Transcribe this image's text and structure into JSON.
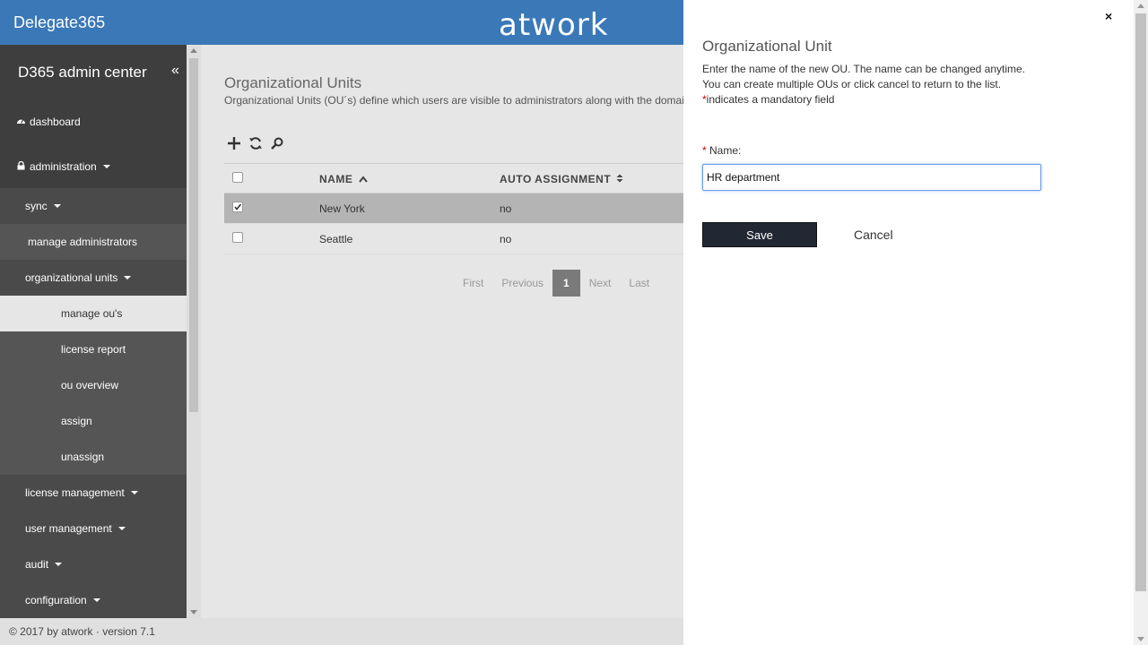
{
  "header": {
    "brand": "Delegate365",
    "logo": "atwork"
  },
  "sidebar": {
    "title": "D365 admin center",
    "collapse_icon": "«",
    "items": [
      {
        "label": "dashboard",
        "icon": "dashboard-icon"
      },
      {
        "label": "administration",
        "icon": "lock-icon"
      },
      {
        "label": "sync"
      },
      {
        "label": "manage administrators"
      },
      {
        "label": "organizational units"
      },
      {
        "label": "manage ou's"
      },
      {
        "label": "license report"
      },
      {
        "label": "ou overview"
      },
      {
        "label": "assign"
      },
      {
        "label": "unassign"
      },
      {
        "label": "license management"
      },
      {
        "label": "user management"
      },
      {
        "label": "audit"
      },
      {
        "label": "configuration"
      }
    ]
  },
  "main": {
    "title": "Organizational Units",
    "description": "Organizational Units (OU´s) define which users are visible to administrators along with the domai",
    "toolbar": {
      "add_icon": "plus-icon",
      "refresh_icon": "refresh-icon",
      "search_icon": "search-icon"
    },
    "table": {
      "columns": [
        "NAME",
        "AUTO ASSIGNMENT"
      ],
      "rows": [
        {
          "name": "New York",
          "auto_assignment": "no",
          "selected": true
        },
        {
          "name": "Seattle",
          "auto_assignment": "no",
          "selected": false
        }
      ]
    },
    "pager": {
      "first": "First",
      "previous": "Previous",
      "current": "1",
      "next": "Next",
      "last": "Last"
    }
  },
  "footer": {
    "text": "© 2017 by atwork · version 7.1"
  },
  "dialog": {
    "title": "Organizational Unit",
    "line1": "Enter the name of the new OU. The name can be changed anytime.",
    "line2": "You can create multiple OUs or click cancel to return to the list.",
    "required_marker": "*",
    "line3": "indicates a mandatory field",
    "name_label": "Name:",
    "name_value": "HR department",
    "save_label": "Save",
    "cancel_label": "Cancel",
    "close_icon": "×"
  },
  "colors": {
    "header_bg": "#3a78b8",
    "sidebar_bg": "#3e3e3e",
    "save_bg": "#222833",
    "selected_row": "#b4b4b4",
    "required": "#cc0000"
  }
}
